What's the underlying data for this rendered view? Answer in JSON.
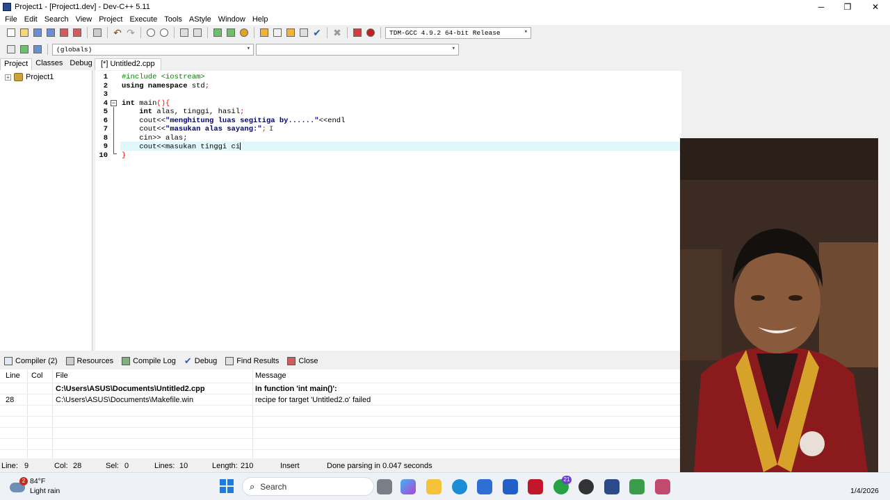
{
  "window": {
    "title": "Project1 - [Project1.dev] - Dev-C++ 5.11",
    "minimize": "─",
    "maximize": "❐",
    "close": "✕"
  },
  "menu": [
    "File",
    "Edit",
    "Search",
    "View",
    "Project",
    "Execute",
    "Tools",
    "AStyle",
    "Window",
    "Help"
  ],
  "toolbar": {
    "compiler_select": "TDM-GCC 4.9.2 64-bit Release",
    "scope_select": "(globals)",
    "function_select": ""
  },
  "left_panel": {
    "tabs": [
      "Project",
      "Classes",
      "Debug"
    ],
    "tree_item": "Project1"
  },
  "editor": {
    "tab": "[*] Untitled2.cpp",
    "line_numbers": [
      "1",
      "2",
      "3",
      "4",
      "5",
      "6",
      "7",
      "8",
      "9",
      "10"
    ],
    "current_line": 9,
    "code": {
      "l1": "#include <iostream>",
      "l2a": "using namespace",
      "l2b": " std",
      "l2c": ";",
      "l4a": "int",
      "l4b": " main",
      "l4c": "(){",
      "l5a": "    int",
      "l5b": " alas, tinggi, hasil",
      "l5c": ";",
      "l6a": "    cout<<",
      "l6b": "\"menghitung luas segitiga by......\"",
      "l6c": "<<endl",
      "l7a": "    cout<<",
      "l7b": "\"masukan alas sayang:\"",
      "l7c": ";",
      "l8a": "    cin>>",
      "l8b": " alas;",
      "l9": "    cout<<masukan tinggi ci",
      "l10": "}"
    }
  },
  "bottom_panel": {
    "tabs": [
      "Compiler (2)",
      "Resources",
      "Compile Log",
      "Debug",
      "Find Results",
      "Close"
    ],
    "columns": [
      "Line",
      "Col",
      "File",
      "Message"
    ],
    "rows": [
      {
        "line": "",
        "col": "",
        "file": "C:\\Users\\ASUS\\Documents\\Untitled2.cpp",
        "message": "In function 'int main()':"
      },
      {
        "line": "28",
        "col": "",
        "file": "C:\\Users\\ASUS\\Documents\\Makefile.win",
        "message": "recipe for target 'Untitled2.o' failed"
      }
    ]
  },
  "statusbar": {
    "line_label": "Line:",
    "line_value": "9",
    "col_label": "Col:",
    "col_value": "28",
    "sel_label": "Sel:",
    "sel_value": "0",
    "lines_label": "Lines:",
    "lines_value": "10",
    "length_label": "Length:",
    "length_value": "210",
    "mode": "Insert",
    "message": "Done parsing in 0.047 seconds"
  },
  "taskbar": {
    "weather_badge": "2",
    "temperature": "84°F",
    "weather_desc": "Light rain",
    "search_label": "Search",
    "whatsapp_badge": "21",
    "date": "1/4/2026"
  },
  "colors": {
    "current_line": "#e1f8fb",
    "string": "#000080",
    "preprocessor": "#008000",
    "symbol": "#ff0000",
    "accent": "#0067c0"
  }
}
